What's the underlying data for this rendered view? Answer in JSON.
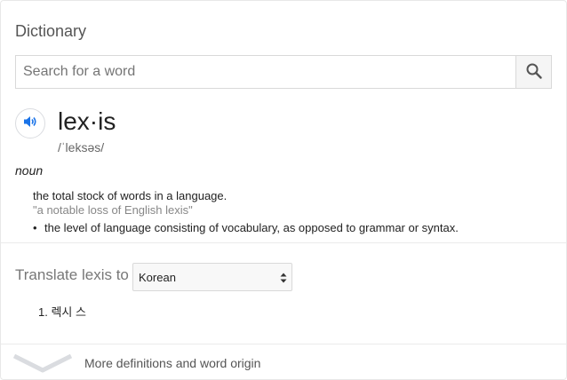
{
  "header": {
    "title": "Dictionary"
  },
  "search": {
    "placeholder": "Search for a word",
    "value": ""
  },
  "entry": {
    "word": "lex·is",
    "phonetic": "/ˈleksəs/",
    "part_of_speech": "noun",
    "definition": "the total stock of words in a language.",
    "example": "\"a notable loss of English lexis\"",
    "subsense": "the level of language consisting of vocabulary, as opposed to grammar or syntax.",
    "bullet": "•"
  },
  "translate": {
    "label": "Translate lexis to",
    "selected_language": "Korean",
    "results": [
      "1. 렉시 스"
    ]
  },
  "footer": {
    "more_label": "More definitions and word origin"
  },
  "colors": {
    "accent": "#1a73e8",
    "text": "#222222",
    "muted": "#777777",
    "example": "#878787",
    "border": "#d9d9d9"
  },
  "icons": {
    "search": "search-icon",
    "speaker": "speaker-icon",
    "select_arrows": "select-arrows-icon",
    "expand": "chevron-down-icon"
  }
}
